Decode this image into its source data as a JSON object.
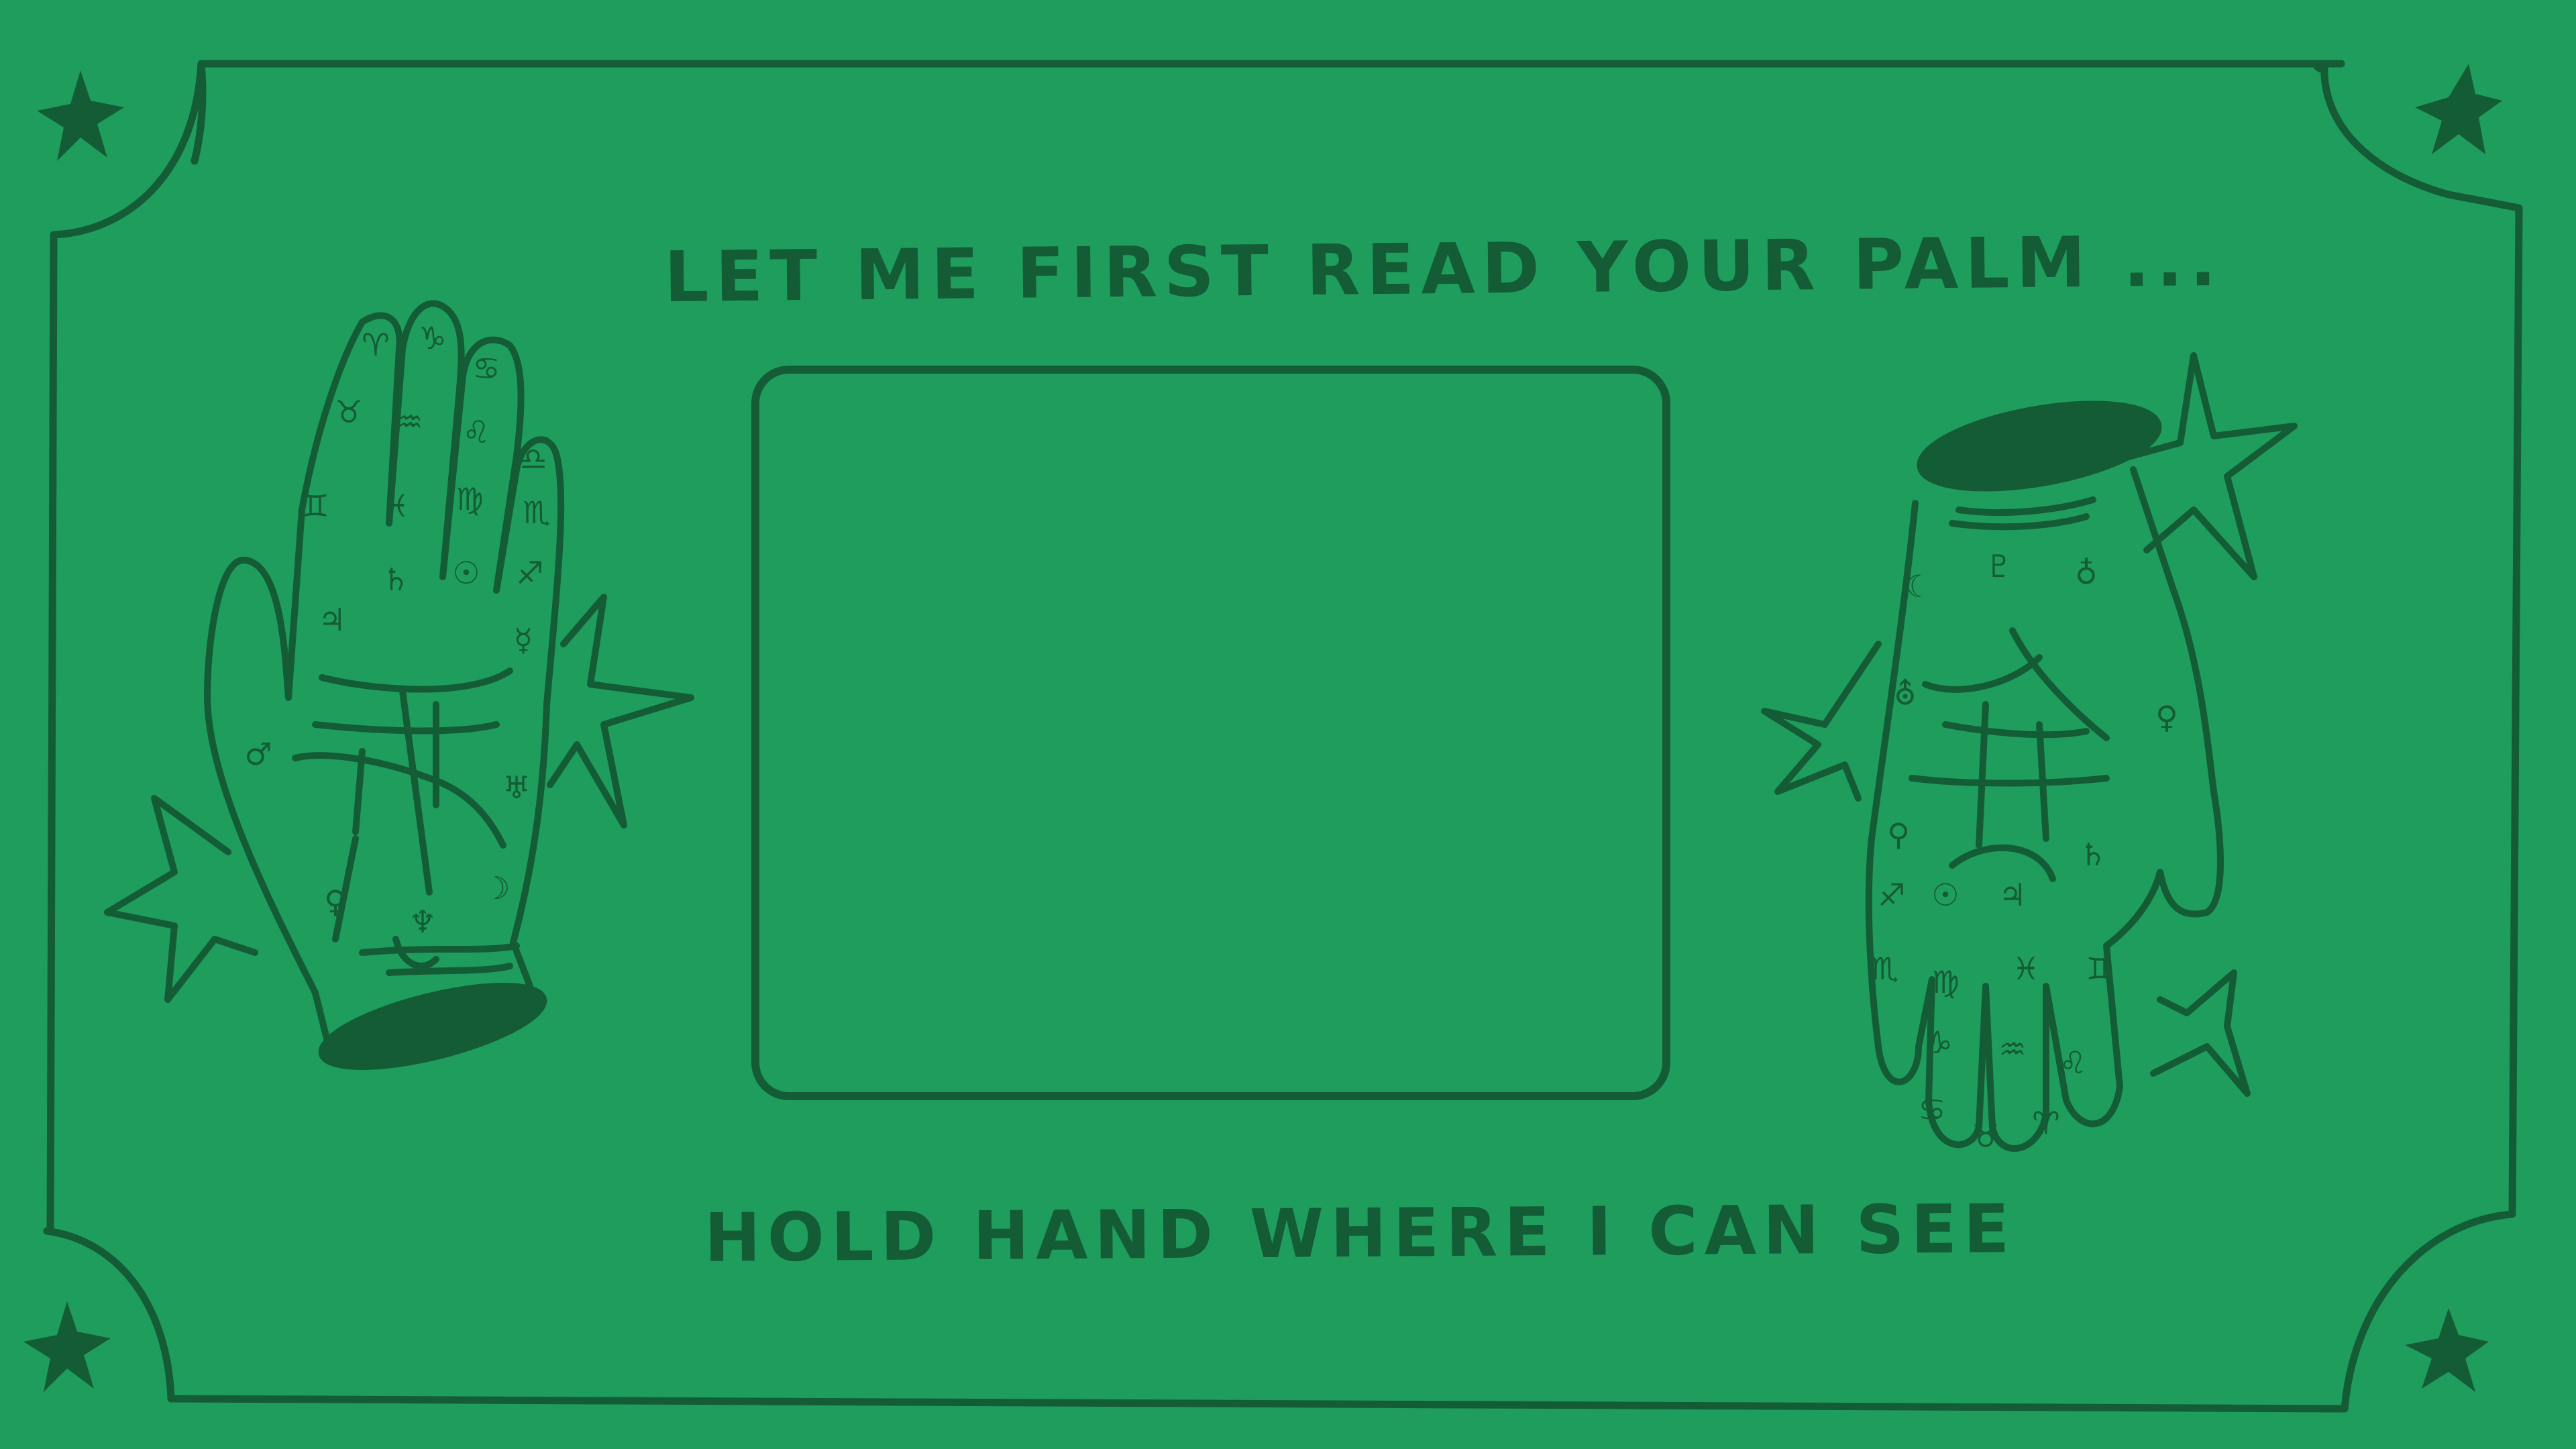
{
  "screen": {
    "background_color": "#1f9d5c",
    "ink_color": "#145c35"
  },
  "prompts": {
    "top": "LET ME FIRST READ YOUR PALM ...",
    "bottom": "HOLD HAND WHERE I CAN SEE"
  },
  "icons": {
    "left_hand": "palm-chart-hand-icon",
    "right_hand": "palm-chart-hand-icon",
    "stars": "star-icon",
    "frame": "ornate-frame"
  }
}
